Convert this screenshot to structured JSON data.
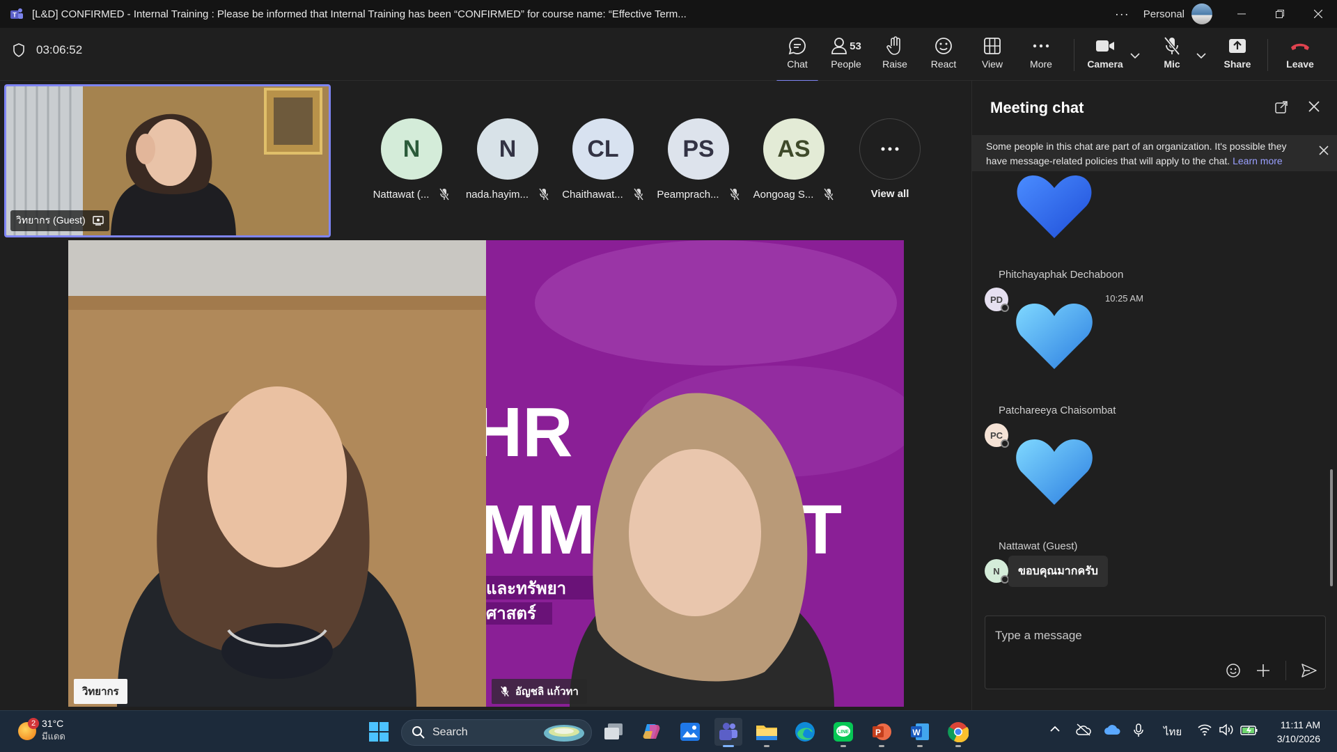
{
  "window": {
    "title": "[L&D] CONFIRMED - Internal Training : Please be informed that Internal Training has been “CONFIRMED” for course name: “Effective Term...",
    "profile_label": "Personal",
    "more_label": "···"
  },
  "toolbar": {
    "timer": "03:06:52",
    "chat_label": "Chat",
    "people_label": "People",
    "people_count": "53",
    "raise_label": "Raise",
    "react_label": "React",
    "view_label": "View",
    "more_label": "More",
    "camera_label": "Camera",
    "mic_label": "Mic",
    "share_label": "Share",
    "leave_label": "Leave"
  },
  "stage": {
    "selfview_name": "วิทยากร (Guest)",
    "participants": [
      {
        "initials": "N",
        "name": "Nattawat (...",
        "color": "#d4ecd9"
      },
      {
        "initials": "N",
        "name": "nada.hayim...",
        "color": "#d8e2e8"
      },
      {
        "initials": "CL",
        "name": "Chaithawat...",
        "color": "#d8e2f0"
      },
      {
        "initials": "PS",
        "name": "Peamprach...",
        "color": "#dde3ec"
      },
      {
        "initials": "AS",
        "name": "Aongoag S...",
        "color": "#e3ebd6"
      }
    ],
    "view_all_label": "View all",
    "video_left_name": "วิทยากร",
    "video_right_name": "อัญชลิ แก้วทา",
    "backdrop_text_1": "HR",
    "backdrop_text_2": "MM",
    "backdrop_text_3": "T",
    "backdrop_text_4": "และทรัพยา",
    "backdrop_text_5": "ศาสตร์"
  },
  "chat": {
    "title": "Meeting chat",
    "banner_text": "Some people in this chat are part of an organization. It's possible they have message-related policies that will apply to the chat.",
    "banner_link": "Learn more",
    "messages": [
      {
        "sender": "Phitchayaphak Dechaboon",
        "initials": "PD",
        "time": "10:25 AM",
        "color": "#e6e0f0"
      },
      {
        "sender": "Patchareeya Chaisombat",
        "initials": "PC",
        "color": "#f5e3d6"
      },
      {
        "sender": "Nattawat (Guest)",
        "initials": "N",
        "text": "ขอบคุณมากครับ",
        "color": "#d4ecd9"
      }
    ],
    "composer_placeholder": "Type a message"
  },
  "taskbar": {
    "weather_temp": "31°C",
    "weather_desc": "มีแดด",
    "weather_badge": "2",
    "search_label": "Search",
    "language": "ไทย",
    "time": "11:11 AM",
    "date": "3/10/2026"
  },
  "colors": {
    "accent": "#7f85f5",
    "leave": "#e0434f",
    "chat_background": "#1f1f1f",
    "backdrop_purple": "#8a1f96"
  }
}
